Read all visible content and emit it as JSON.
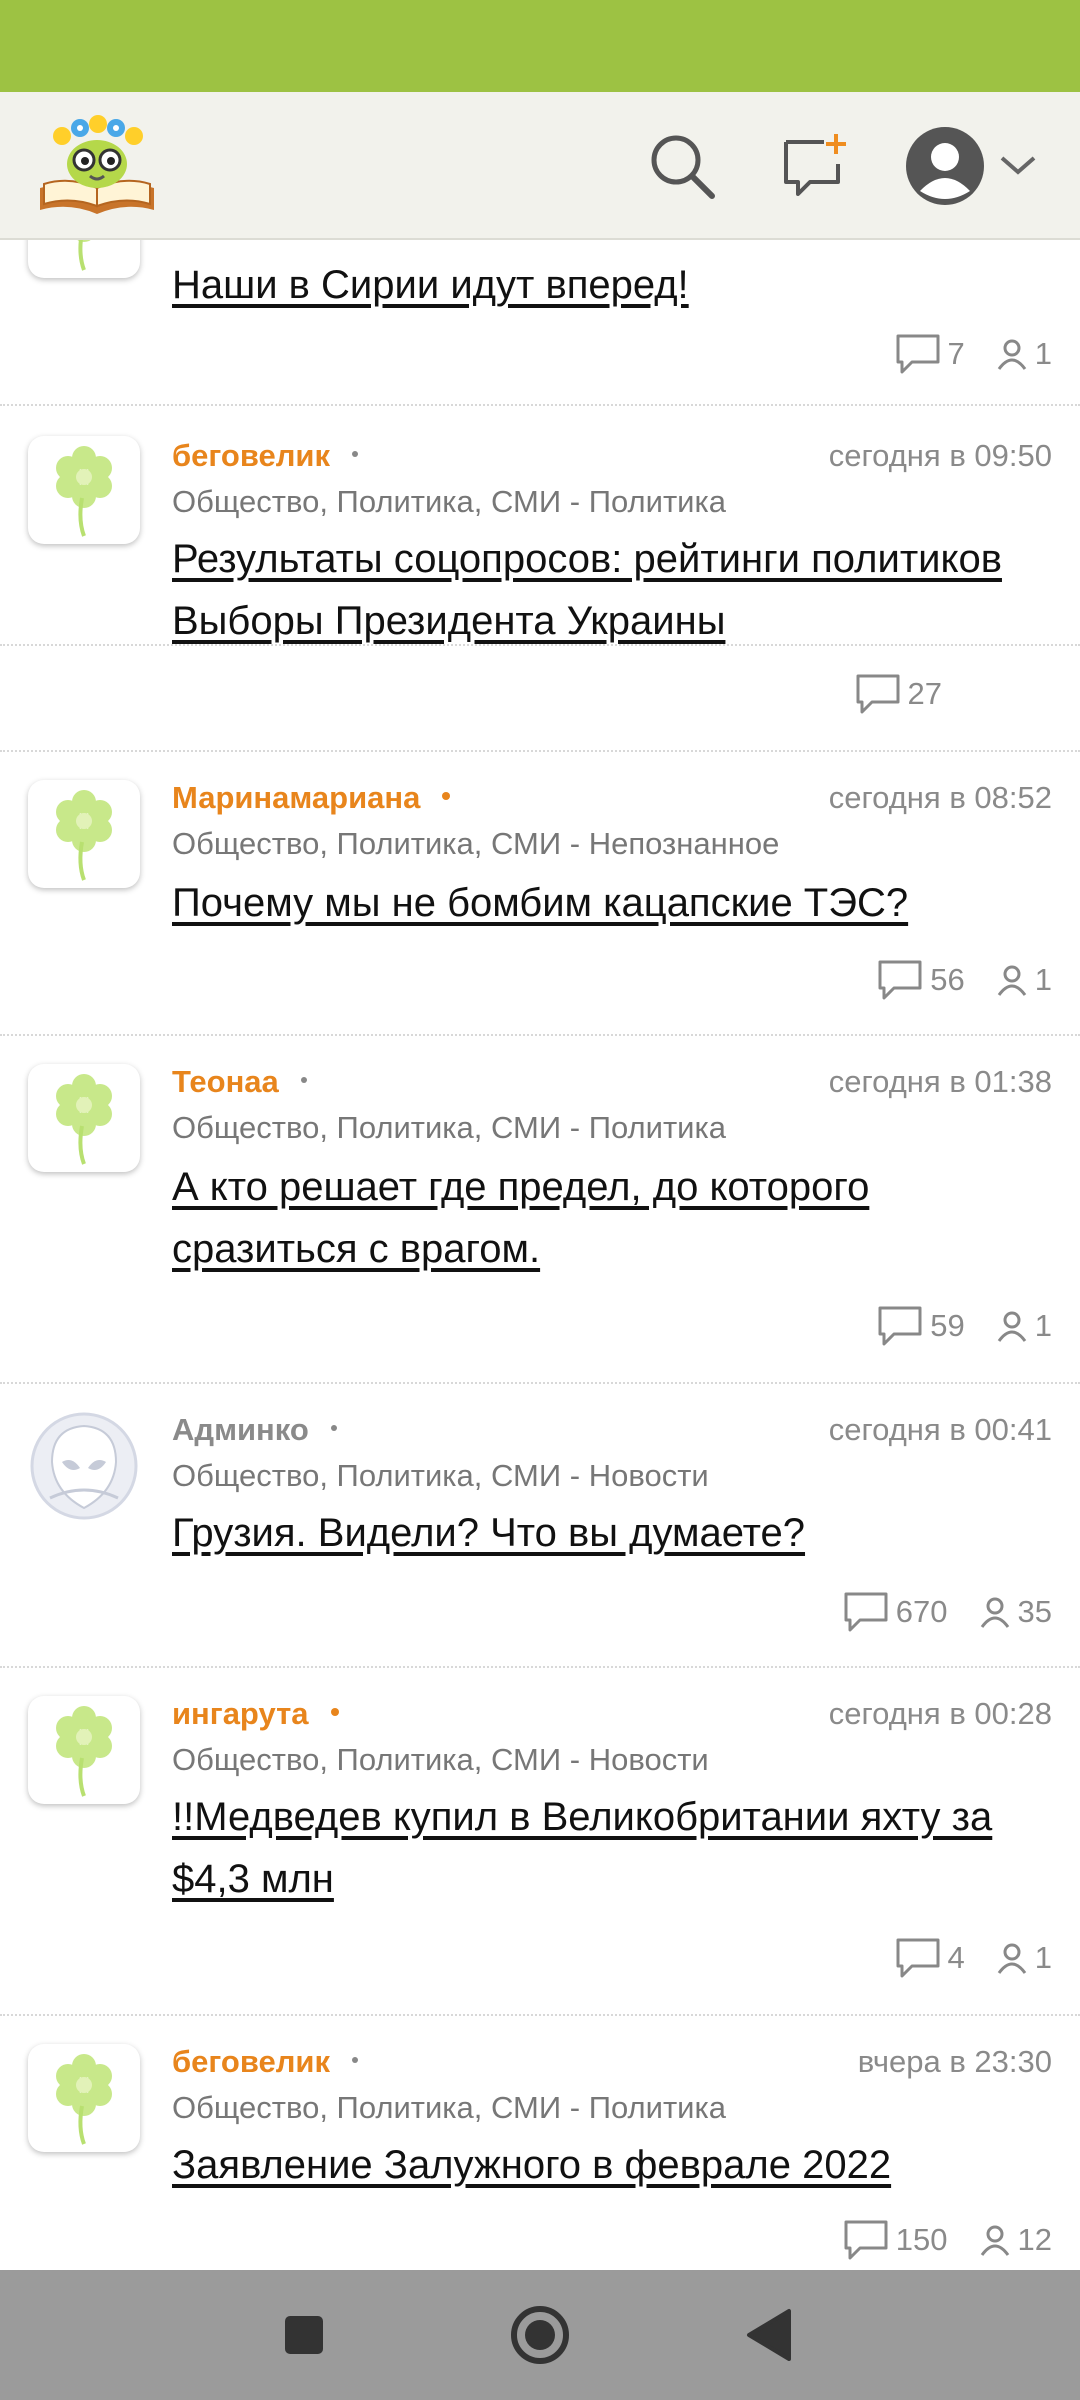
{
  "header": {
    "logo": "site-logo",
    "search_icon": "search-icon",
    "new_post_icon": "new-message-icon",
    "user_icon": "user-avatar-icon",
    "menu_icon": "chevron-down-icon"
  },
  "posts": [
    {
      "title": "Наши в Сирии идут вперед!",
      "comments": "7",
      "participants": "1"
    },
    {
      "author": "беговелик",
      "time": "сегодня в 09:50",
      "category": "Общество, Политика, СМИ - Политика",
      "title": "Результаты соцопросов: рейтинги политиков Выборы Президента Украины",
      "comments": "27"
    },
    {
      "author": "Маринамариана",
      "time": "сегодня в 08:52",
      "category": "Общество, Политика, СМИ - Непознанное",
      "title": "Почему мы не бомбим кацапские ТЭС?",
      "comments": "56",
      "participants": "1"
    },
    {
      "author": "Теонаа",
      "time": "сегодня в 01:38",
      "category": "Общество, Политика, СМИ - Политика",
      "title": "А кто решает где предел, до которого сразиться с врагом.",
      "comments": "59",
      "participants": "1"
    },
    {
      "author": "Админко",
      "time": "сегодня в 00:41",
      "category": "Общество, Политика, СМИ - Новости",
      "title": "Грузия. Видели? Что вы думаете?",
      "comments": "670",
      "participants": "35"
    },
    {
      "author": "ингарута",
      "time": "сегодня в 00:28",
      "category": "Общество, Политика, СМИ - Новости",
      "title": "!!Медведев купил в Великобритании яхту за $4,3 млн",
      "comments": "4",
      "participants": "1"
    },
    {
      "author": "беговелик",
      "time": "вчера в 23:30",
      "category": "Общество, Политика, СМИ - Политика",
      "title": "Заявление Залужного в феврале 2022",
      "comments": "150",
      "participants": "12"
    }
  ],
  "colors": {
    "status_bar": "#9dc243",
    "author_online": "#e8851c",
    "author_admin": "#8a8a8a",
    "nav_bar": "#9b9b9b"
  },
  "navigation": {
    "recents_icon": "square-icon",
    "home_icon": "circle-home-icon",
    "back_icon": "triangle-back-icon"
  }
}
